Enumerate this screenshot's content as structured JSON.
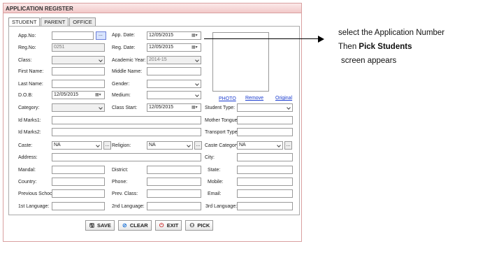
{
  "window": {
    "title": "APPLICATION REGISTER"
  },
  "tabs": [
    "STUDENT",
    "PARENT",
    "OFFICE"
  ],
  "form": {
    "app_no_label": "App.No:",
    "app_no_value": "",
    "app_date_label": "App. Date:",
    "app_date_value": "12/05/2015",
    "reg_no_label": "Reg.No:",
    "reg_no_value": "0251",
    "reg_date_label": "Reg. Date:",
    "reg_date_value": "12/05/2015",
    "class_label": "Class:",
    "class_value": "",
    "acad_year_label": "Academic Year:",
    "acad_year_value": "2014-15",
    "first_name_label": "First Name:",
    "middle_name_label": "Middle Name:",
    "last_name_label": "Last Name:",
    "gender_label": "Gender:",
    "dob_label": "D.O.B:",
    "dob_value": "12/05/2015",
    "medium_label": "Medium:",
    "category_label": "Category:",
    "class_start_label": "Class Start:",
    "class_start_value": "12/05/2015",
    "student_type_label": "Student Type:",
    "id_marks1_label": "Id Marks1:",
    "mother_tongue_label": "Mother Tongue:",
    "id_marks2_label": "Id Marks2:",
    "transport_type_label": "Transport Type:",
    "caste_label": "Caste:",
    "caste_value": "NA",
    "religion_label": "Religion:",
    "religion_value": "NA",
    "caste_category_label": "Caste Category:",
    "caste_category_value": "NA",
    "address_label": "Address:",
    "city_label": "City:",
    "mandal_label": "Mandal:",
    "district_label": "District:",
    "state_label": "State:",
    "country_label": "Country:",
    "phone_label": "Phone:",
    "mobile_label": "Mobile:",
    "prev_school_label": "Previous School:",
    "prev_class_label": "Prev. Class:",
    "email_label": "Email:",
    "lang1_label": "1st Language:",
    "lang2_label": "2nd Language:",
    "lang3_label": "3rd Language:"
  },
  "photo": {
    "photo_link": "PHOTO",
    "remove_link": "Remove",
    "original_link": "Original"
  },
  "buttons": {
    "save": "SAVE",
    "clear": "CLEAR",
    "exit": "EXIT",
    "pick": "PICK"
  },
  "browse_glyph": "...",
  "annotation": {
    "line1": "select  the Application Number",
    "line2_prefix": "Then ",
    "line2_bold": "Pick Students",
    "line3": "screen appears"
  }
}
